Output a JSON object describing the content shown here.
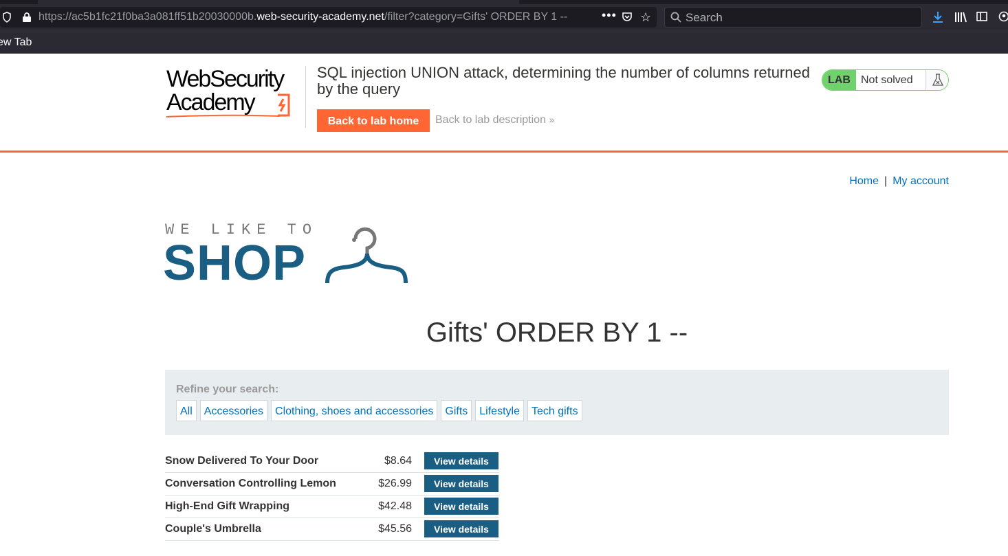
{
  "browser": {
    "url_prefix": "https://ac5b1fc21f0ba3a081ff51b20030000b.",
    "url_domain": "web-security-academy.net",
    "url_path": "/filter?category=Gifts' ORDER BY 1 --",
    "search_placeholder": "Search",
    "bookmark": "ew Tab"
  },
  "lab": {
    "logo_line1": "WebSecurity",
    "logo_line2": "Academy",
    "title": "SQL injection UNION attack, determining the number of columns returned by the query",
    "back_home": "Back to lab home",
    "back_description": "Back to lab description",
    "status_badge": "LAB",
    "status_text": "Not solved",
    "status_color": "#70d16d",
    "accent_color": "#ff6633"
  },
  "nav": {
    "home": "Home",
    "separator": "|",
    "my_account": "My account"
  },
  "shop_logo": {
    "tagline": "WE LIKE TO",
    "word": "SHOP"
  },
  "heading": "Gifts' ORDER BY 1 --",
  "filters": {
    "label": "Refine your search:",
    "categories": [
      "All",
      "Accessories",
      "Clothing, shoes and accessories",
      "Gifts",
      "Lifestyle",
      "Tech gifts"
    ]
  },
  "products": [
    {
      "name": "Snow Delivered To Your Door",
      "price": "$8.64",
      "action": "View details"
    },
    {
      "name": "Conversation Controlling Lemon",
      "price": "$26.99",
      "action": "View details"
    },
    {
      "name": "High-End Gift Wrapping",
      "price": "$42.48",
      "action": "View details"
    },
    {
      "name": "Couple's Umbrella",
      "price": "$45.56",
      "action": "View details"
    }
  ]
}
